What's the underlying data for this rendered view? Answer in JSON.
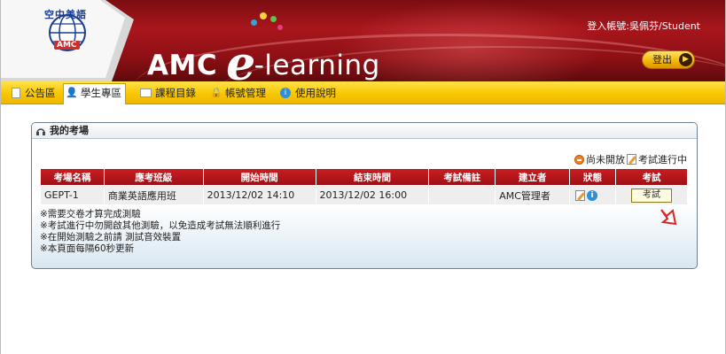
{
  "header": {
    "logo_top_text": "空中美語",
    "logo_sub_text": "AMC",
    "brand_amc": "AMC",
    "brand_e": "e",
    "brand_learning": "-learning",
    "login_info": "登入帳號:吳佩芬/Student",
    "logout_label": "登出",
    "colors": {
      "banner": "#a8161c",
      "tabbar": "#f8c700",
      "table_header": "#c81d22"
    }
  },
  "tabs": [
    {
      "label": "公告區",
      "icon": "document-icon"
    },
    {
      "label": "學生專區",
      "icon": "student-icon",
      "active": true
    },
    {
      "label": "課程目錄",
      "icon": "book-icon"
    },
    {
      "label": "帳號管理",
      "icon": "lock-icon"
    },
    {
      "label": "使用說明",
      "icon": "info-icon"
    }
  ],
  "panel": {
    "title": "我的考場",
    "legend": {
      "not_open": "尚未開放",
      "in_progress": "考試進行中"
    },
    "columns": [
      "考場名稱",
      "應考班級",
      "開始時間",
      "結束時間",
      "考試備註",
      "建立者",
      "狀態",
      "考試"
    ],
    "rows": [
      {
        "name": "GEPT-1",
        "class": "商業英語應用班",
        "start": "2013/12/02 14:10",
        "end": "2013/12/02 16:00",
        "note": "",
        "creator": "AMC管理者",
        "status_icons": [
          "edit-icon",
          "info-icon"
        ],
        "action": "考試"
      }
    ],
    "notes": [
      "※需要交卷才算完成測驗",
      "※考試進行中勿開啟其他測驗，以免造成考試無法順利進行",
      "※在開始測驗之前請 測試音效裝置",
      "※本頁面每隔60秒更新"
    ]
  }
}
